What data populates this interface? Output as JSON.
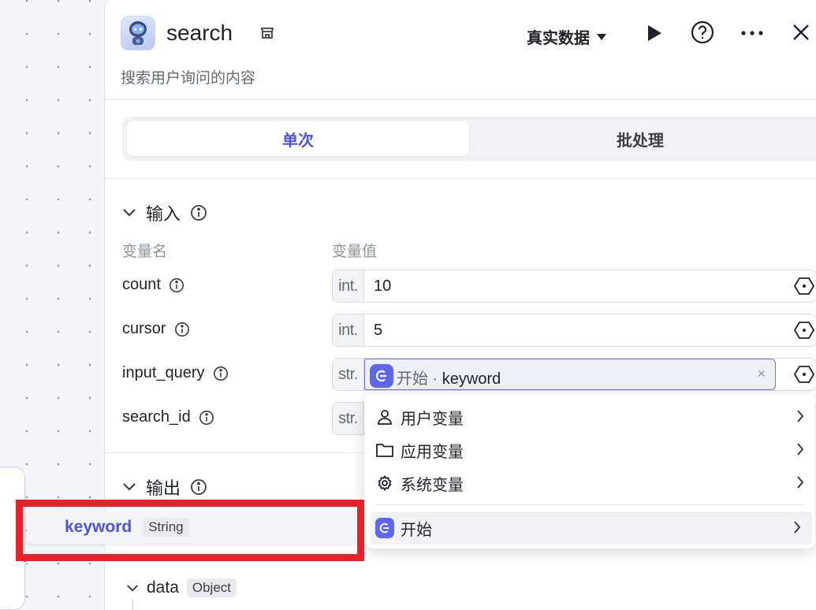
{
  "header": {
    "title": "search",
    "description": "搜索用户询问的内容",
    "data_mode": "真实数据"
  },
  "tabs": [
    {
      "label": "单次",
      "active": true
    },
    {
      "label": "批处理",
      "active": false
    }
  ],
  "input_section": {
    "title": "输入",
    "col_name": "变量名",
    "col_value": "变量值",
    "rows": [
      {
        "name": "count",
        "type": "int.",
        "value": "10"
      },
      {
        "name": "cursor",
        "type": "int.",
        "value": "5"
      },
      {
        "name": "input_query",
        "type": "str.",
        "ref_node": "开始",
        "ref_sep": " · ",
        "ref_var": "keyword",
        "clear": "×"
      },
      {
        "name": "search_id",
        "type": "str."
      }
    ]
  },
  "dropdown": {
    "items": [
      {
        "label": "用户变量",
        "icon": "user-icon"
      },
      {
        "label": "应用变量",
        "icon": "folder-icon"
      },
      {
        "label": "系统变量",
        "icon": "gear-icon"
      },
      {
        "label": "开始",
        "icon": "start-node-icon"
      }
    ]
  },
  "output_section": {
    "title": "输出",
    "dragging_item": {
      "name": "keyword",
      "type": "String"
    },
    "data_item": {
      "name": "data",
      "type": "Object"
    }
  },
  "colors": {
    "accent": "#4d53e8",
    "highlight_border": "#e8202a"
  }
}
